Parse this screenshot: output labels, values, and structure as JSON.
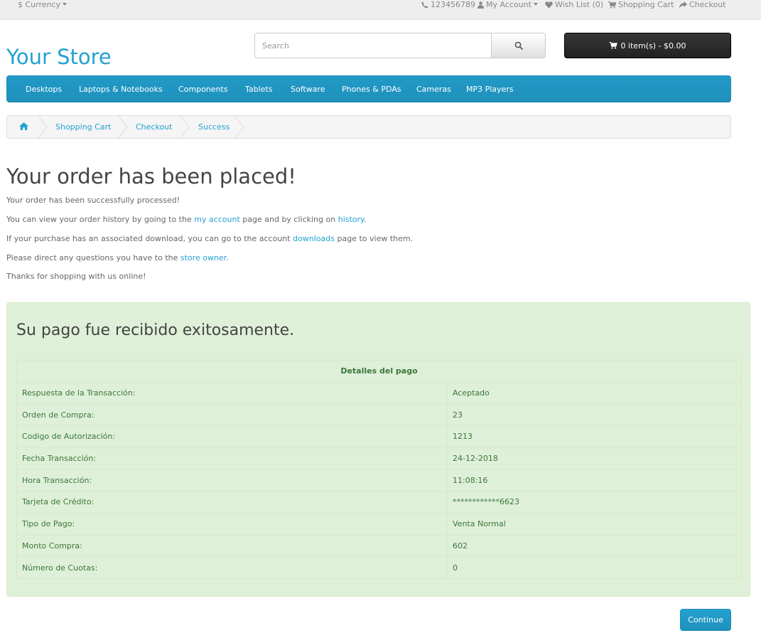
{
  "topbar": {
    "currency_label": "$ Currency",
    "phone": "123456789",
    "my_account": "My Account",
    "wishlist": "Wish List (0)",
    "shopping_cart": "Shopping Cart",
    "checkout": "Checkout"
  },
  "header": {
    "logo": "Your Store",
    "search_placeholder": "Search",
    "cart_button": "0 item(s) - $0.00"
  },
  "menu": [
    "Desktops",
    "Laptops & Notebooks",
    "Components",
    "Tablets",
    "Software",
    "Phones & PDAs",
    "Cameras",
    "MP3 Players"
  ],
  "breadcrumb": [
    "Shopping Cart",
    "Checkout",
    "Success"
  ],
  "content": {
    "title": "Your order has been placed!",
    "p1": "Your order has been successfully processed!",
    "p2_pre": "You can view your order history by going to the ",
    "p2_link1": "my account",
    "p2_mid": " page and by clicking on ",
    "p2_link2": "history",
    "p2_post": ".",
    "p3_pre": "If your purchase has an associated download, you can go to the account ",
    "p3_link": "downloads",
    "p3_post": " page to view them.",
    "p4_pre": "Please direct any questions you have to the ",
    "p4_link": "store owner",
    "p4_post": ".",
    "p5": "Thanks for shopping with us online!"
  },
  "payment": {
    "title": "Su pago fue recibido exitosamente.",
    "table_header": "Detalles del pago",
    "rows": [
      {
        "label": "Respuesta de la Transacción:",
        "value": "Aceptado"
      },
      {
        "label": "Orden de Compra:",
        "value": "23"
      },
      {
        "label": "Codigo de Autorización:",
        "value": "1213"
      },
      {
        "label": "Fecha Transacción:",
        "value": "24-12-2018"
      },
      {
        "label": "Hora Transacción:",
        "value": "11:08:16"
      },
      {
        "label": "Tarjeta de Crédito:",
        "value": "************6623"
      },
      {
        "label": "Tipo de Pago:",
        "value": "Venta Normal"
      },
      {
        "label": "Monto Compra:",
        "value": "602"
      },
      {
        "label": "Número de Cuotas:",
        "value": "0"
      }
    ]
  },
  "continue_label": "Continue",
  "colors": {
    "accent": "#23a1d1",
    "success_bg": "#dff0d8",
    "success_text": "#3c763d"
  }
}
